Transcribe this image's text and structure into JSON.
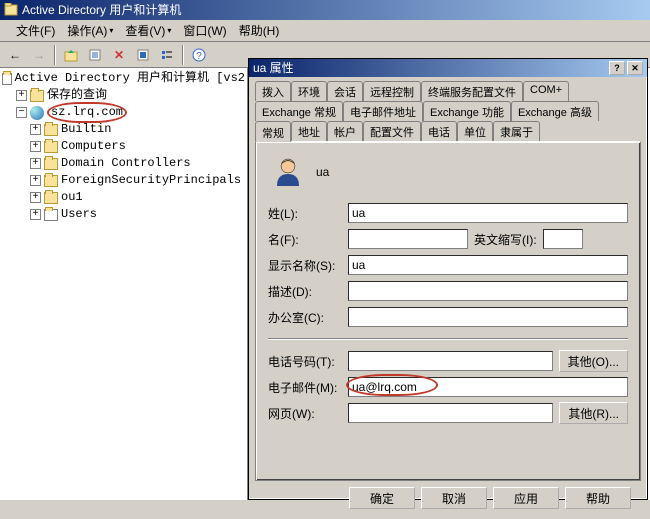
{
  "window": {
    "title": "Active Directory 用户和计算机"
  },
  "menu": {
    "file": "文件(F)",
    "ops": "操作(A)",
    "view": "查看(V)",
    "window": "窗口(W)",
    "help": "帮助(H)"
  },
  "tree": {
    "root": "Active Directory 用户和计算机 [vs2",
    "saved": "保存的查询",
    "domain": "sz.lrq.com",
    "items": [
      "Builtin",
      "Computers",
      "Domain Controllers",
      "ForeignSecurityPrincipals",
      "ou1",
      "Users"
    ]
  },
  "dialog": {
    "title": "ua 属性",
    "tabs_row1": [
      "拨入",
      "环境",
      "会话",
      "远程控制",
      "终端服务配置文件",
      "COM+"
    ],
    "tabs_row2": [
      "Exchange 常规",
      "电子邮件地址",
      "Exchange 功能",
      "Exchange 高级"
    ],
    "tabs_row3": [
      "常规",
      "地址",
      "帐户",
      "配置文件",
      "电话",
      "单位",
      "隶属于"
    ],
    "user_display": "ua",
    "labels": {
      "surname": "姓(L):",
      "given": "名(F):",
      "initials": "英文缩写(I):",
      "display": "显示名称(S):",
      "desc": "描述(D):",
      "office": "办公室(C):",
      "phone": "电话号码(T):",
      "email": "电子邮件(M):",
      "web": "网页(W):",
      "other_o": "其他(O)...",
      "other_r": "其他(R)..."
    },
    "values": {
      "surname": "ua",
      "given": "",
      "initials": "",
      "display": "ua",
      "desc": "",
      "office": "",
      "phone": "",
      "email": "ua@lrq.com",
      "web": ""
    },
    "buttons": {
      "ok": "确定",
      "cancel": "取消",
      "apply": "应用",
      "help": "帮助"
    }
  }
}
